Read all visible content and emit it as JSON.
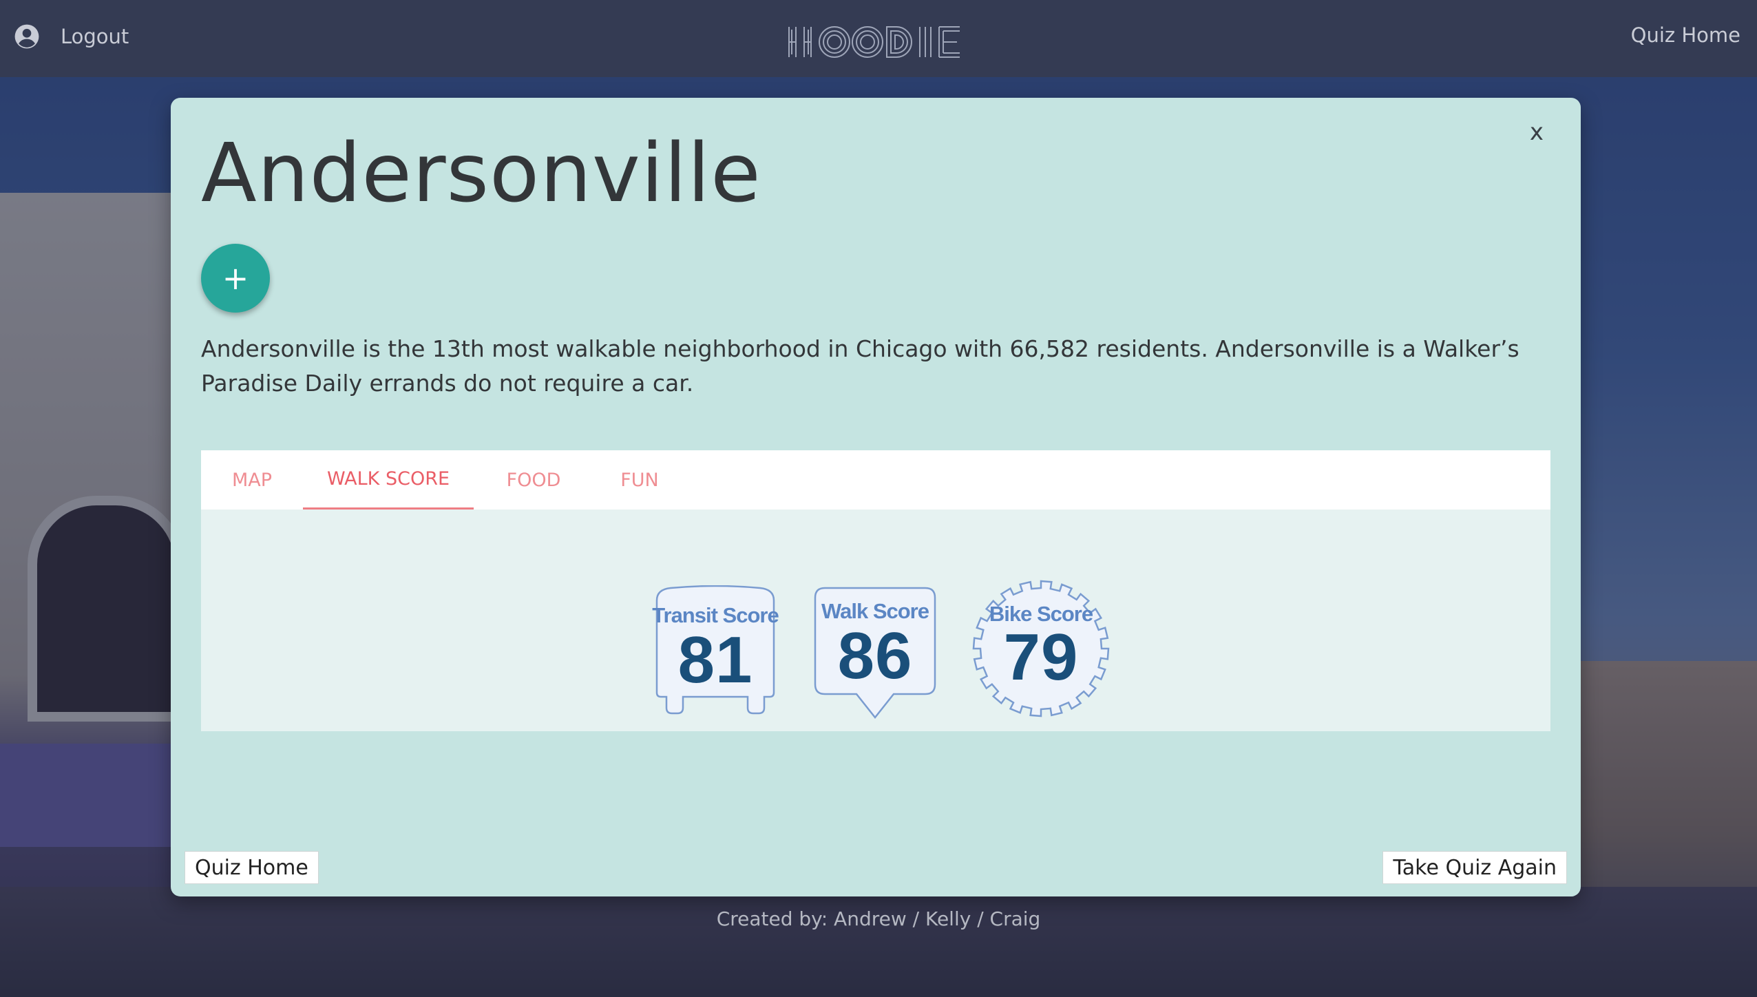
{
  "header": {
    "logout_label": "Logout",
    "logo_text": "HOODIE",
    "quiz_home_label": "Quiz Home"
  },
  "modal": {
    "close_label": "x",
    "title": "Andersonville",
    "add_label": "+",
    "description": "Andersonville is the 13th most walkable neighborhood in Chicago with 66,582 residents. Andersonville is a Walker’s Paradise Daily errands do not require a car.",
    "tabs": [
      {
        "label": "MAP",
        "active": false
      },
      {
        "label": "WALK SCORE",
        "active": true
      },
      {
        "label": "FOOD",
        "active": false
      },
      {
        "label": "FUN",
        "active": false
      }
    ],
    "scores": [
      {
        "label": "Transit Score",
        "value": "81",
        "shape": "bus"
      },
      {
        "label": "Walk Score",
        "value": "86",
        "shape": "pin"
      },
      {
        "label": "Bike Score",
        "value": "79",
        "shape": "gear"
      }
    ],
    "buttons": {
      "quiz_home": "Quiz Home",
      "take_again": "Take Quiz Again"
    }
  },
  "footer": {
    "credits": "Created by: Andrew / Kelly / Craig"
  },
  "colors": {
    "modal_bg": "#c5e4e1",
    "accent": "#26a69a",
    "tab_text": "#ef8d92",
    "score_label": "#5b86c4",
    "score_value": "#1a4f7a"
  }
}
